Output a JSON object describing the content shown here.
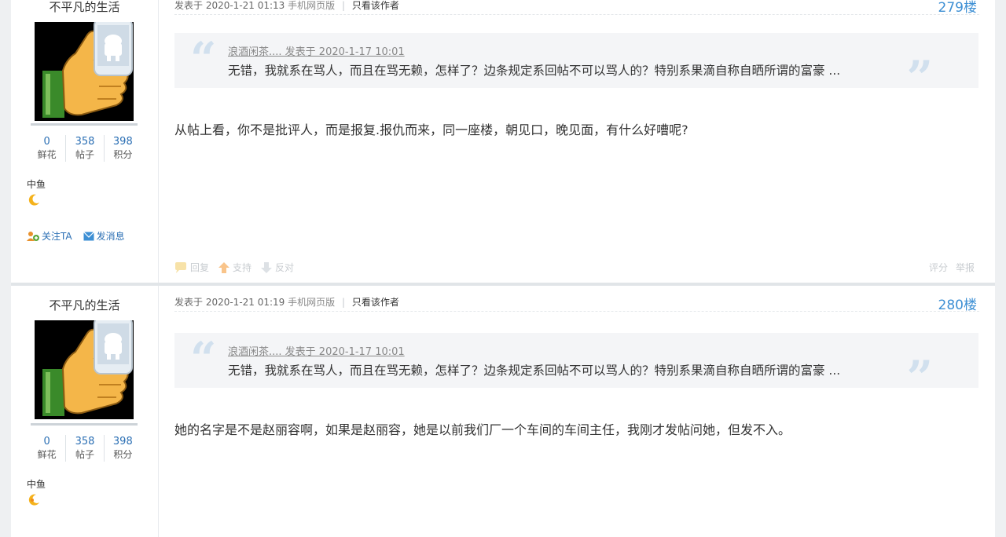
{
  "posts": [
    {
      "username": "不平凡的生活",
      "stats": [
        {
          "value": "0",
          "label": "鲜花"
        },
        {
          "value": "358",
          "label": "帖子"
        },
        {
          "value": "398",
          "label": "积分"
        }
      ],
      "rank": "中鱼",
      "follow_label": "关注TA",
      "message_label": "发消息",
      "meta_posted": "发表于 2020-1-21 01:13",
      "meta_mobile": "手机网页版",
      "meta_sep": "|",
      "meta_author_only": "只看该作者",
      "floor": "279楼",
      "quote_source": "浪酒闲茶.... 发表于 2020-1-17 10:01",
      "quote_text": "无错，我就系在骂人，而且在骂无赖，怎样了？边条规定系回帖不可以骂人的？特别系果滴自称自晒所谓的富豪 ...",
      "body": "从帖上看，你不是批评人，而是报复.报仇而来，同一座楼，朝见口，晚见面，有什么好嘈呢?",
      "footer": {
        "reply": "回复",
        "support": "支持",
        "oppose": "反对",
        "rate": "评分",
        "report": "举报"
      }
    },
    {
      "username": "不平凡的生活",
      "stats": [
        {
          "value": "0",
          "label": "鲜花"
        },
        {
          "value": "358",
          "label": "帖子"
        },
        {
          "value": "398",
          "label": "积分"
        }
      ],
      "rank": "中鱼",
      "meta_posted": "发表于 2020-1-21 01:19",
      "meta_mobile": "手机网页版",
      "meta_sep": "|",
      "meta_author_only": "只看该作者",
      "floor": "280楼",
      "quote_source": "浪酒闲茶.... 发表于 2020-1-17 10:01",
      "quote_text": "无错，我就系在骂人，而且在骂无赖，怎样了？边条规定系回帖不可以骂人的？特别系果滴自称自晒所谓的富豪 ...",
      "body": "她的名字是不是赵丽容啊，如果是赵丽容，她是以前我们厂一个车间的车间主任，我刚才发帖问她，但发不入。"
    }
  ]
}
